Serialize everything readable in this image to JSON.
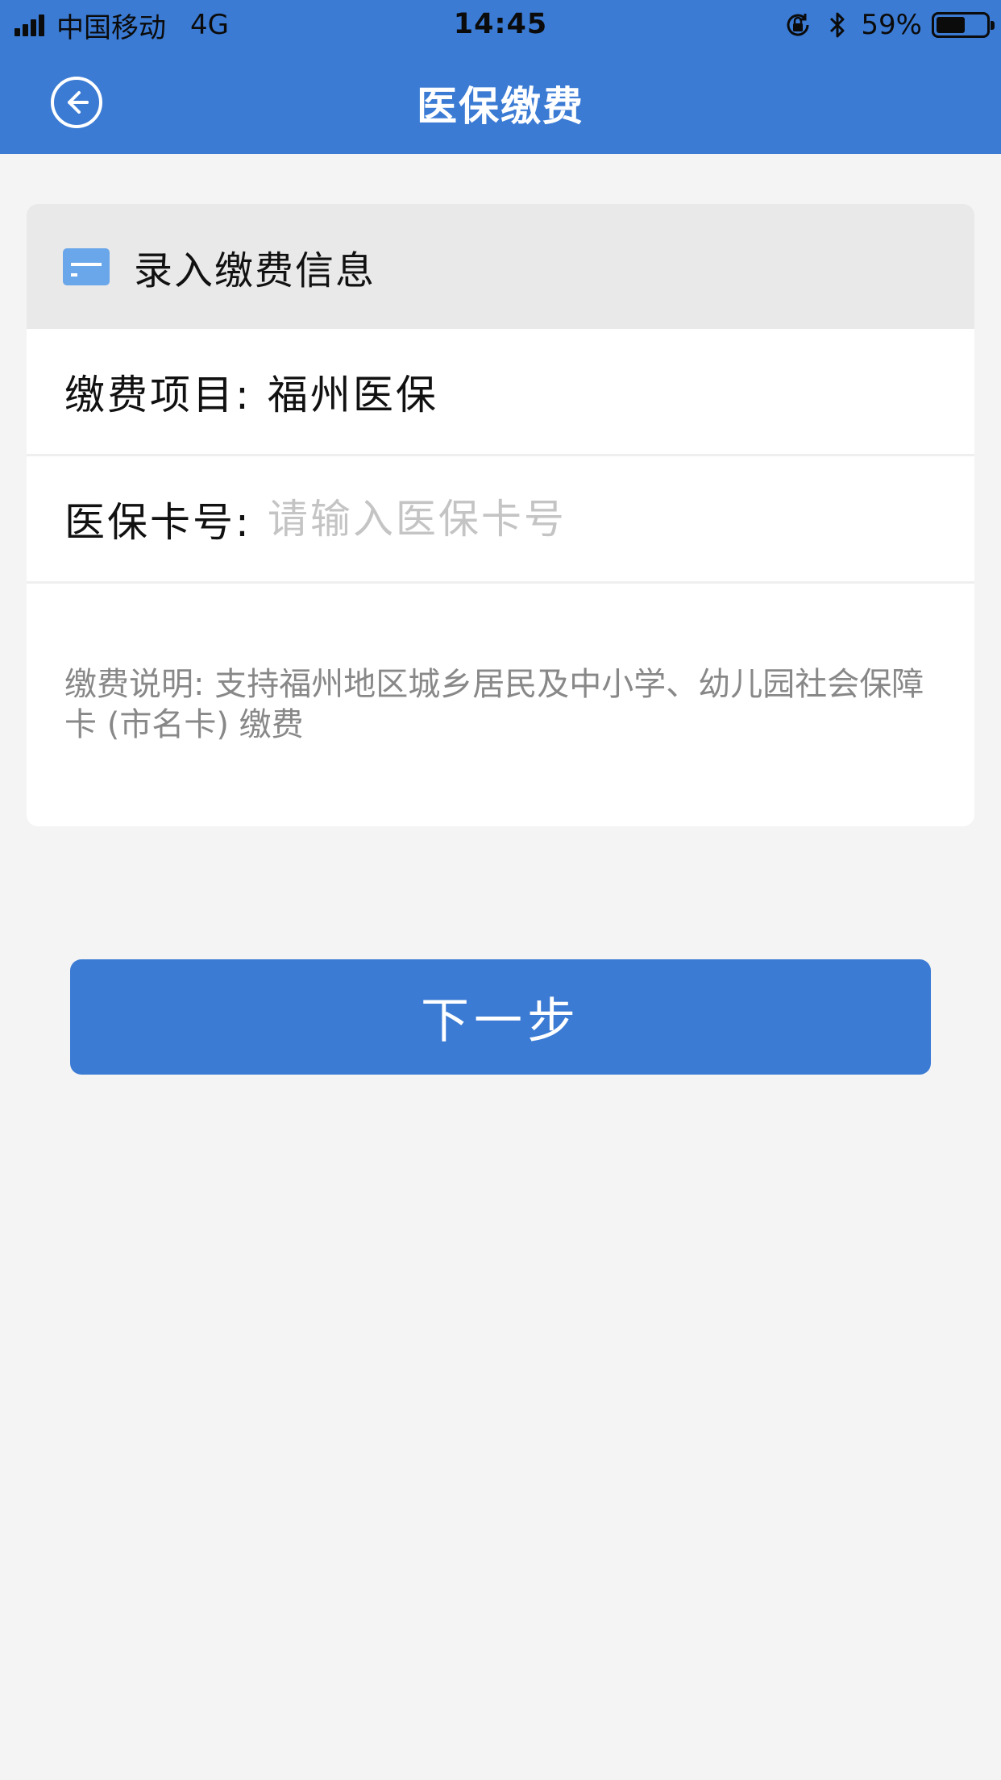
{
  "status_bar": {
    "carrier": "中国移动",
    "network": "4G",
    "time": "14:45",
    "battery_percent": "59%",
    "battery_level": 0.59,
    "icons": [
      "signal-icon",
      "orientation-lock-icon",
      "bluetooth-icon",
      "battery-icon"
    ]
  },
  "header": {
    "title": "医保缴费",
    "back_icon": "back-arrow-circle-icon",
    "background_color": "#3b7bd4"
  },
  "form": {
    "section_title": "录入缴费信息",
    "section_icon": "card-icon",
    "payment_item_label": "缴费项目:",
    "payment_item_value": "福州医保",
    "card_number_label": "医保卡号:",
    "card_number_value": "",
    "card_number_placeholder": "请输入医保卡号",
    "note": "缴费说明: 支持福州地区城乡居民及中小学、幼儿园社会保障卡 (市名卡) 缴费"
  },
  "actions": {
    "next_label": "下一步",
    "button_color": "#3b7bd4"
  }
}
